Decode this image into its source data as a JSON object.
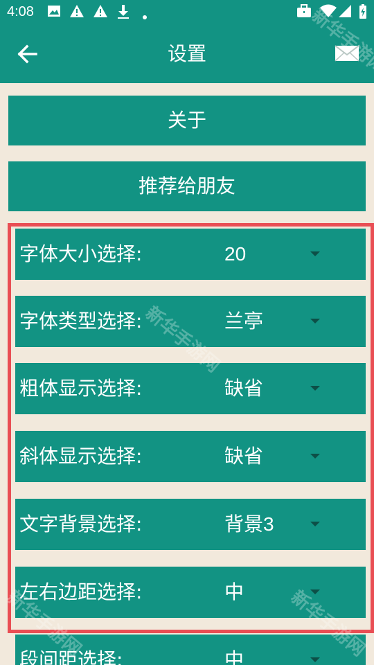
{
  "status_bar": {
    "time": "4:08",
    "left_icons": [
      "image-icon",
      "warning-icon",
      "warning-icon",
      "download-icon",
      "dot-icon"
    ],
    "right_icons": [
      "briefcase-icon",
      "wifi-icon",
      "signal-icon",
      "battery-icon"
    ]
  },
  "app_bar": {
    "title": "设置",
    "back_icon": "arrow-left-icon",
    "mail_icon": "mail-icon",
    "color": "#129383"
  },
  "buttons": {
    "about": "关于",
    "recommend": "推荐给朋友"
  },
  "settings": [
    {
      "label": "字体大小选择:",
      "value": "20"
    },
    {
      "label": "字体类型选择:",
      "value": "兰亭"
    },
    {
      "label": "粗体显示选择:",
      "value": "缺省"
    },
    {
      "label": "斜体显示选择:",
      "value": "缺省"
    },
    {
      "label": "文字背景选择:",
      "value": "背景3"
    },
    {
      "label": "左右边距选择:",
      "value": "中"
    },
    {
      "label": "段间距选择:",
      "value": "中"
    }
  ],
  "watermark": "新华手游网",
  "colors": {
    "primary": "#129383",
    "background": "#f2e9dc",
    "highlight": "#e94e54"
  }
}
